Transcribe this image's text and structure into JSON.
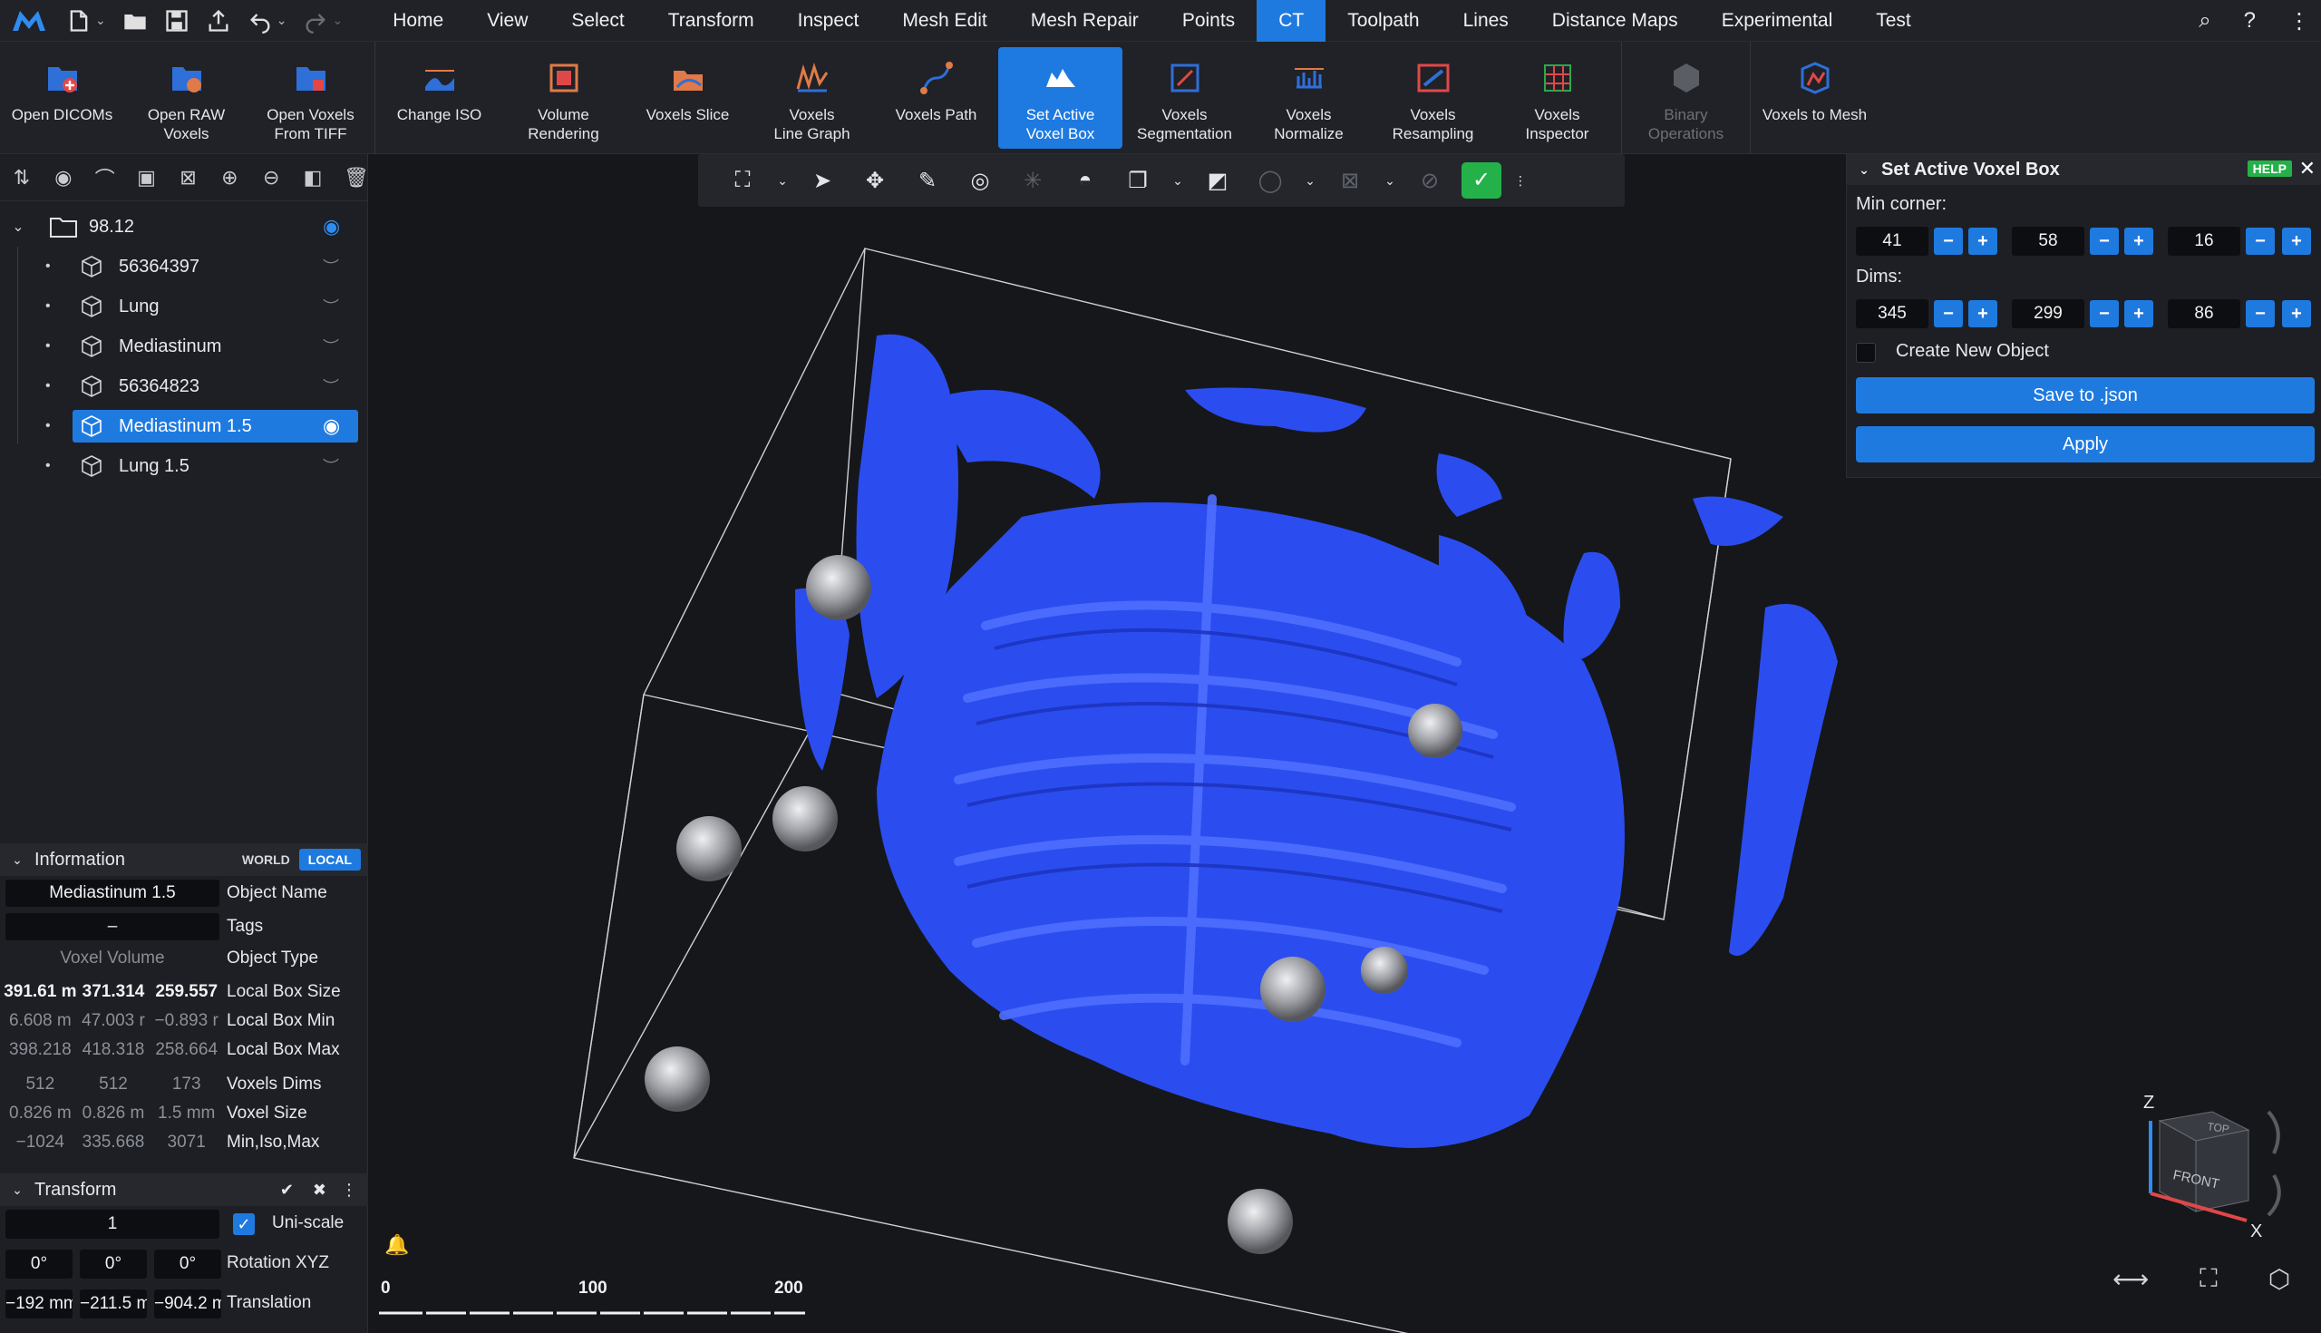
{
  "app": {
    "logo_icon": "app-logo-icon",
    "accent": "#1f7ae0",
    "voxel_color": "#2b4df0"
  },
  "quick_access": [
    {
      "icon": "new-file-icon"
    },
    {
      "icon": "open-folder-icon"
    },
    {
      "icon": "save-icon"
    },
    {
      "icon": "export-icon"
    },
    {
      "icon": "undo-icon"
    },
    {
      "icon": "redo-icon"
    }
  ],
  "menu": [
    "Home",
    "View",
    "Select",
    "Transform",
    "Inspect",
    "Mesh Edit",
    "Mesh Repair",
    "Points",
    "CT",
    "Toolpath",
    "Lines",
    "Distance Maps",
    "Experimental",
    "Test"
  ],
  "menu_active": "CT",
  "ribbon": [
    {
      "label": "Open DICOMs",
      "icon": "open-dicoms-icon"
    },
    {
      "label": "Open RAW\nVoxels",
      "icon": "open-raw-voxels-icon"
    },
    {
      "label": "Open Voxels\nFrom TIFF",
      "icon": "open-tiff-icon"
    },
    {
      "label": "Change ISO",
      "icon": "change-iso-icon"
    },
    {
      "label": "Volume\nRendering",
      "icon": "volume-rendering-icon"
    },
    {
      "label": "Voxels Slice",
      "icon": "voxels-slice-icon"
    },
    {
      "label": "Voxels\nLine Graph",
      "icon": "line-graph-icon"
    },
    {
      "label": "Voxels Path",
      "icon": "voxels-path-icon"
    },
    {
      "label": "Set Active\nVoxel Box",
      "icon": "voxel-box-icon",
      "active": true
    },
    {
      "label": "Voxels\nSegmentation",
      "icon": "segmentation-icon"
    },
    {
      "label": "Voxels\nNormalize",
      "icon": "normalize-icon"
    },
    {
      "label": "Voxels\nResampling",
      "icon": "resampling-icon"
    },
    {
      "label": "Voxels\nInspector",
      "icon": "inspector-icon"
    },
    {
      "label": "Binary\nOperations",
      "icon": "binary-operations-icon",
      "disabled": true
    },
    {
      "label": "Voxels to Mesh",
      "icon": "voxels-to-mesh-icon"
    }
  ],
  "tree": {
    "root": "98.12",
    "items": [
      "56364397",
      "Lung",
      "Mediastinum",
      "56364823",
      "Mediastinum 1.5",
      "Lung 1.5"
    ],
    "selected_index": 4
  },
  "information": {
    "title": "Information",
    "world_label": "WORLD",
    "local_label": "LOCAL",
    "object_name": "Mediastinum 1.5",
    "object_name_label": "Object Name",
    "tags": "–",
    "tags_label": "Tags",
    "object_type": "Voxel Volume",
    "object_type_label": "Object Type",
    "local_box_size": [
      "391.61 m",
      "371.314",
      "259.557"
    ],
    "local_box_size_label": "Local Box Size",
    "local_box_min": [
      "6.608 m",
      "47.003 r",
      "−0.893 r"
    ],
    "local_box_min_label": "Local Box Min",
    "local_box_max": [
      "398.218",
      "418.318",
      "258.664"
    ],
    "local_box_max_label": "Local Box Max",
    "voxels_dims": [
      "512",
      "512",
      "173"
    ],
    "voxels_dims_label": "Voxels Dims",
    "voxel_size": [
      "0.826 m",
      "0.826 m",
      "1.5 mm"
    ],
    "voxel_size_label": "Voxel Size",
    "min_iso_max": [
      "−1024",
      "335.668",
      "3071"
    ],
    "min_iso_max_label": "Min,Iso,Max"
  },
  "transform": {
    "title": "Transform",
    "scale": "1",
    "uniscale_label": "Uni-scale",
    "rotation": [
      "0°",
      "0°",
      "0°"
    ],
    "rotation_label": "Rotation XYZ",
    "translation": [
      "−192 mm",
      "−211.5 m",
      "−904.2 m"
    ],
    "translation_label": "Translation"
  },
  "dialog": {
    "title": "Set Active Voxel Box",
    "help": "HELP",
    "min_corner_label": "Min corner:",
    "min_corner": [
      "41",
      "58",
      "16"
    ],
    "dims_label": "Dims:",
    "dims": [
      "345",
      "299",
      "86"
    ],
    "create_new_label": "Create New Object",
    "save_label": "Save to .json",
    "apply_label": "Apply"
  },
  "scale_bar": {
    "labels": [
      "0",
      "100",
      "200"
    ]
  },
  "nav_cube": {
    "top": "TOP",
    "front": "FRONT",
    "z": "Z",
    "x": "X"
  }
}
